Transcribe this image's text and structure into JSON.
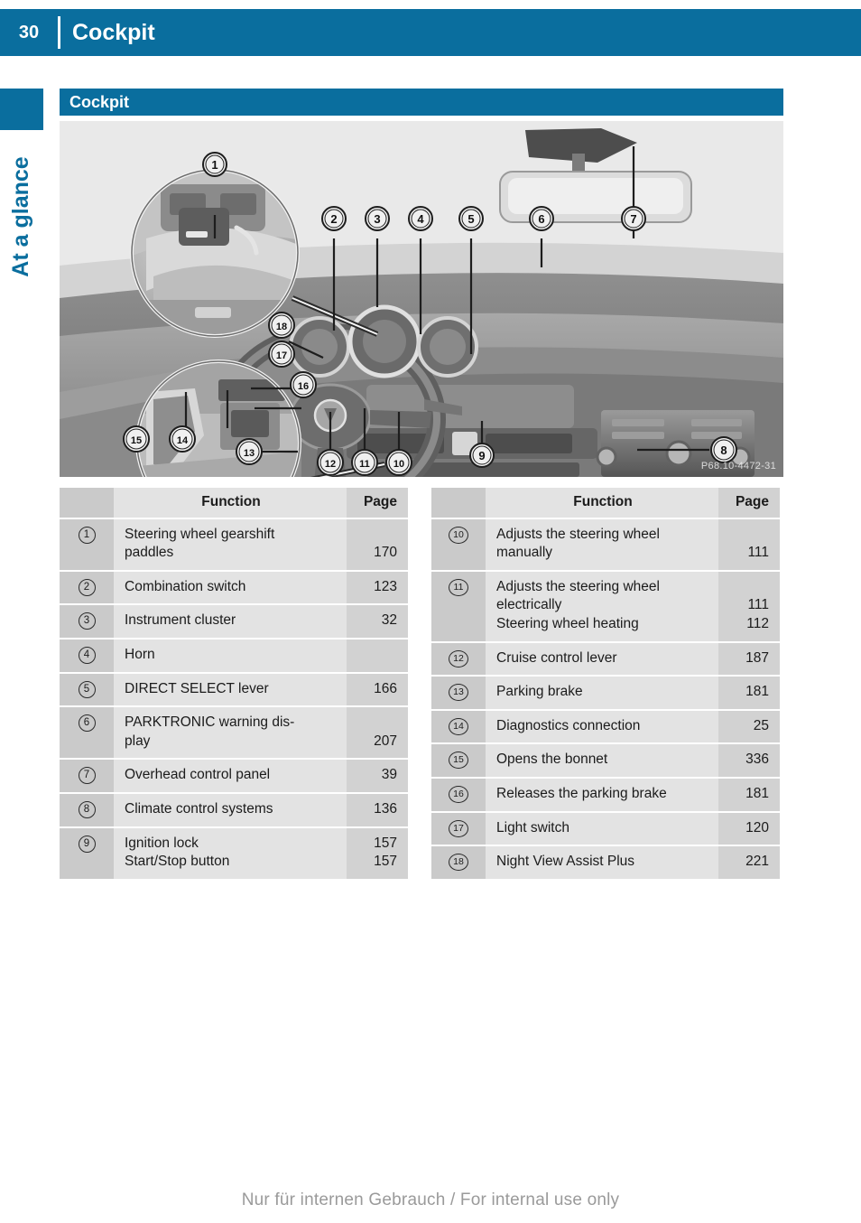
{
  "running_header": {
    "page_number": "30",
    "title": "Cockpit",
    "bar_color": "#0a6e9e"
  },
  "rail": {
    "label": "At a glance",
    "color": "#0a6e9e"
  },
  "section": {
    "title": "Cockpit",
    "bar_color": "#0a6e9e"
  },
  "figure": {
    "alt": "Grayscale photograph of a Mercedes-Benz cockpit with two circular magnified insets and numbered callouts 1 through 18",
    "image_code": "P68.10-4472-31",
    "callouts": [
      "1",
      "2",
      "3",
      "4",
      "5",
      "6",
      "7",
      "8",
      "9",
      "10",
      "11",
      "12",
      "13",
      "14",
      "15",
      "16",
      "17",
      "18"
    ]
  },
  "tables": [
    {
      "id": "left",
      "headers": {
        "num": "",
        "function": "Function",
        "page": "Page"
      },
      "rows": [
        {
          "num": "1",
          "function_lines": [
            "Steering wheel gearshift",
            "paddles"
          ],
          "page_lines": [
            "",
            "170"
          ]
        },
        {
          "num": "2",
          "function_lines": [
            "Combination switch"
          ],
          "page_lines": [
            "123"
          ]
        },
        {
          "num": "3",
          "function_lines": [
            "Instrument cluster"
          ],
          "page_lines": [
            "32"
          ]
        },
        {
          "num": "4",
          "function_lines": [
            "Horn"
          ],
          "page_lines": [
            ""
          ]
        },
        {
          "num": "5",
          "function_lines": [
            "DIRECT SELECT lever"
          ],
          "page_lines": [
            "166"
          ]
        },
        {
          "num": "6",
          "function_lines": [
            "PARKTRONIC warning dis-",
            "play"
          ],
          "page_lines": [
            "",
            "207"
          ]
        },
        {
          "num": "7",
          "function_lines": [
            "Overhead control panel"
          ],
          "page_lines": [
            "39"
          ]
        },
        {
          "num": "8",
          "function_lines": [
            "Climate control systems"
          ],
          "page_lines": [
            "136"
          ]
        },
        {
          "num": "9",
          "function_lines": [
            "Ignition lock",
            "Start/Stop button"
          ],
          "page_lines": [
            "157",
            "157"
          ]
        }
      ]
    },
    {
      "id": "right",
      "headers": {
        "num": "",
        "function": "Function",
        "page": "Page"
      },
      "rows": [
        {
          "num": "10",
          "function_lines": [
            "Adjusts the steering wheel",
            "manually"
          ],
          "page_lines": [
            "",
            "111"
          ]
        },
        {
          "num": "11",
          "function_lines": [
            "Adjusts the steering wheel",
            "electrically",
            "Steering wheel heating"
          ],
          "page_lines": [
            "",
            "111",
            "112"
          ]
        },
        {
          "num": "12",
          "function_lines": [
            "Cruise control lever"
          ],
          "page_lines": [
            "187"
          ]
        },
        {
          "num": "13",
          "function_lines": [
            "Parking brake"
          ],
          "page_lines": [
            "181"
          ]
        },
        {
          "num": "14",
          "function_lines": [
            "Diagnostics connection"
          ],
          "page_lines": [
            "25"
          ]
        },
        {
          "num": "15",
          "function_lines": [
            "Opens the bonnet"
          ],
          "page_lines": [
            "336"
          ]
        },
        {
          "num": "16",
          "function_lines": [
            "Releases the parking brake"
          ],
          "page_lines": [
            "181"
          ]
        },
        {
          "num": "17",
          "function_lines": [
            "Light switch"
          ],
          "page_lines": [
            "120"
          ]
        },
        {
          "num": "18",
          "function_lines": [
            "Night View Assist Plus"
          ],
          "page_lines": [
            "221"
          ]
        }
      ]
    }
  ],
  "footer": {
    "text": "Nur für internen Gebrauch / For internal use only"
  }
}
